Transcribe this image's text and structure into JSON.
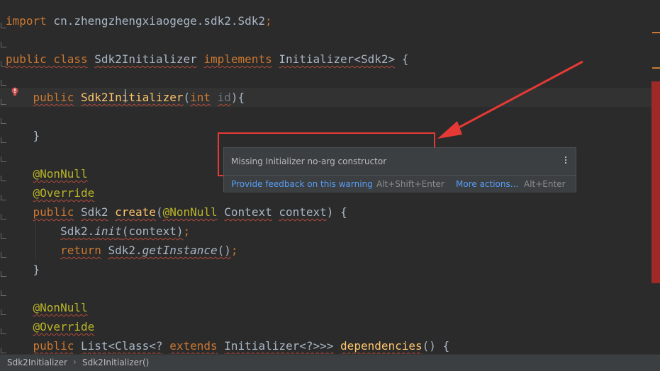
{
  "editor": {
    "lines": [
      {
        "tokens": [
          {
            "t": "import",
            "c": "kw"
          },
          {
            "t": " cn.zhengzhengxiaogege.sdk2.Sdk2",
            "c": ""
          },
          {
            "t": ";",
            "c": "kw"
          }
        ]
      },
      {
        "tokens": []
      },
      {
        "tokens": [
          {
            "t": "public class",
            "c": "kw squig"
          },
          {
            "t": " ",
            "c": ""
          },
          {
            "t": "Sdk2Initializer",
            "c": "squig"
          },
          {
            "t": " ",
            "c": ""
          },
          {
            "t": "implements",
            "c": "kw squig"
          },
          {
            "t": " ",
            "c": ""
          },
          {
            "t": "Initializer<Sdk2>",
            "c": "squig"
          },
          {
            "t": " {",
            "c": ""
          }
        ]
      },
      {
        "tokens": []
      },
      {
        "tokens": [
          {
            "t": "    ",
            "c": ""
          },
          {
            "t": "public",
            "c": "kw squig"
          },
          {
            "t": " ",
            "c": ""
          },
          {
            "t": "Sdk2Initializer",
            "c": "fn squig"
          },
          {
            "t": "(",
            "c": ""
          },
          {
            "t": "int",
            "c": "kw squig"
          },
          {
            "t": " ",
            "c": ""
          },
          {
            "t": "id",
            "c": "param squig"
          },
          {
            "t": "){",
            "c": ""
          }
        ]
      },
      {
        "tokens": []
      },
      {
        "tokens": [
          {
            "t": "    }",
            "c": ""
          }
        ]
      },
      {
        "tokens": []
      },
      {
        "tokens": [
          {
            "t": "    ",
            "c": ""
          },
          {
            "t": "@NonNull",
            "c": "ann squig"
          }
        ]
      },
      {
        "tokens": [
          {
            "t": "    ",
            "c": ""
          },
          {
            "t": "@Override",
            "c": "ann squig"
          }
        ]
      },
      {
        "tokens": [
          {
            "t": "    ",
            "c": ""
          },
          {
            "t": "public",
            "c": "kw squig"
          },
          {
            "t": " ",
            "c": ""
          },
          {
            "t": "Sdk2",
            "c": "squig"
          },
          {
            "t": " ",
            "c": ""
          },
          {
            "t": "create",
            "c": "fn squig"
          },
          {
            "t": "(",
            "c": ""
          },
          {
            "t": "@NonNull",
            "c": "ann squig"
          },
          {
            "t": " ",
            "c": ""
          },
          {
            "t": "Context",
            "c": "squig"
          },
          {
            "t": " ",
            "c": ""
          },
          {
            "t": "context",
            "c": "squig"
          },
          {
            "t": ") {",
            "c": ""
          }
        ]
      },
      {
        "tokens": [
          {
            "t": "        ",
            "c": ""
          },
          {
            "t": "Sdk2.",
            "c": "squig"
          },
          {
            "t": "init",
            "c": "it squig"
          },
          {
            "t": "(context)",
            "c": "squig"
          },
          {
            "t": ";",
            "c": "kw"
          }
        ]
      },
      {
        "tokens": [
          {
            "t": "        ",
            "c": ""
          },
          {
            "t": "return",
            "c": "kw squig"
          },
          {
            "t": " ",
            "c": ""
          },
          {
            "t": "Sdk2.",
            "c": "squig"
          },
          {
            "t": "getInstance",
            "c": "it squig"
          },
          {
            "t": "()",
            "c": "squig"
          },
          {
            "t": ";",
            "c": "kw"
          }
        ]
      },
      {
        "tokens": [
          {
            "t": "    }",
            "c": ""
          }
        ]
      },
      {
        "tokens": []
      },
      {
        "tokens": [
          {
            "t": "    ",
            "c": ""
          },
          {
            "t": "@NonNull",
            "c": "ann squig"
          }
        ]
      },
      {
        "tokens": [
          {
            "t": "    ",
            "c": ""
          },
          {
            "t": "@Override",
            "c": "ann squig"
          }
        ]
      },
      {
        "tokens": [
          {
            "t": "    ",
            "c": ""
          },
          {
            "t": "public",
            "c": "kw squig"
          },
          {
            "t": " ",
            "c": ""
          },
          {
            "t": "List<Class<?",
            "c": "squig"
          },
          {
            "t": " ",
            "c": ""
          },
          {
            "t": "extends",
            "c": "kw squig"
          },
          {
            "t": " ",
            "c": ""
          },
          {
            "t": "Initializer<?>>>",
            "c": "squig"
          },
          {
            "t": " ",
            "c": ""
          },
          {
            "t": "dependencies",
            "c": "fn squig"
          },
          {
            "t": "() {",
            "c": ""
          }
        ]
      }
    ]
  },
  "popup": {
    "message": "Missing Initializer no-arg constructor",
    "feedback_link": "Provide feedback on this warning",
    "feedback_shortcut": "Alt+Shift+Enter",
    "more_actions_link": "More actions...",
    "more_actions_shortcut": "Alt+Enter",
    "menu_icon": "vertical-ellipsis-icon"
  },
  "breadcrumb": {
    "items": [
      "Sdk2Initializer",
      "Sdk2Initializer()"
    ],
    "separator": "›"
  },
  "colors": {
    "background": "#2b2b2b",
    "keyword": "#cc7832",
    "annotation": "#bbb529",
    "function": "#ffc66d",
    "text": "#a9b7c6",
    "link": "#589df6",
    "annotation_box": "#e53935"
  }
}
